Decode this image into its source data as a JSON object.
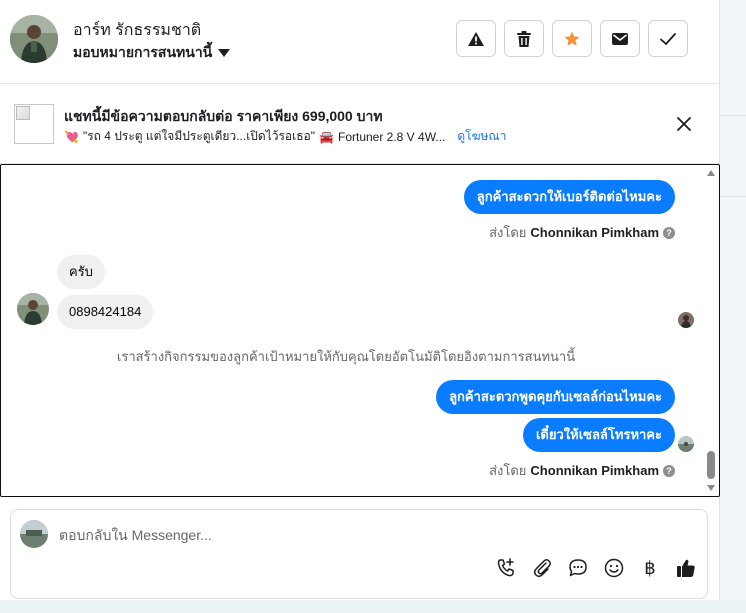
{
  "header": {
    "contact_name": "อาร์ท รักธรรมชาติ",
    "assign_label": "มอบหมายการสนทนานี้"
  },
  "ad": {
    "title": "แชทนี้มีข้อความตอบกลับต่อ ราคาเพียง 699,000 บาท",
    "heart": "💘",
    "subtitle": "\"รถ 4 ประตู แต่ใจมีประตูเดียว...เปิดไว้รอเธอ\"",
    "car": "🚘",
    "model": "Fortuner 2.8 V 4W...",
    "link": "ดูโฆษณา"
  },
  "messages": {
    "out1": "ลูกค้าสะดวกให้เบอร์ติดต่อไหมคะ",
    "sent_by_1_prefix": "ส่งโดย",
    "sent_by_1_name": "Chonnikan Pimkham",
    "in1": "ครับ",
    "in2": "0898424184",
    "system_note": "เราสร้างกิจกรรมของลูกค้าเป้าหมายให้กับคุณโดยอัตโนมัติโดยอิงตามการสนทนานี้",
    "out2": "ลูกค้าสะดวกพูดคุยกับเซลล์ก่อนไหมคะ",
    "out3": "เดี๋ยวให้เซลล์โทรหาคะ",
    "sent_by_2_prefix": "ส่งโดย",
    "sent_by_2_name": "Chonnikan Pimkham",
    "help": "?"
  },
  "composer": {
    "placeholder": "ตอบกลับใน Messenger...",
    "baht_symbol": "฿"
  },
  "colors": {
    "outgoing_bubble": "#0a7cff",
    "incoming_bubble": "#f0f0f0",
    "star_accent": "#f7923a",
    "link": "#1876f2"
  },
  "icons": [
    "warning-icon",
    "trash-icon",
    "star-icon",
    "envelope-icon",
    "check-icon",
    "close-icon",
    "add-call-icon",
    "paperclip-icon",
    "chat-bubble-icon",
    "smiley-icon",
    "baht-icon",
    "thumbs-up-icon"
  ]
}
